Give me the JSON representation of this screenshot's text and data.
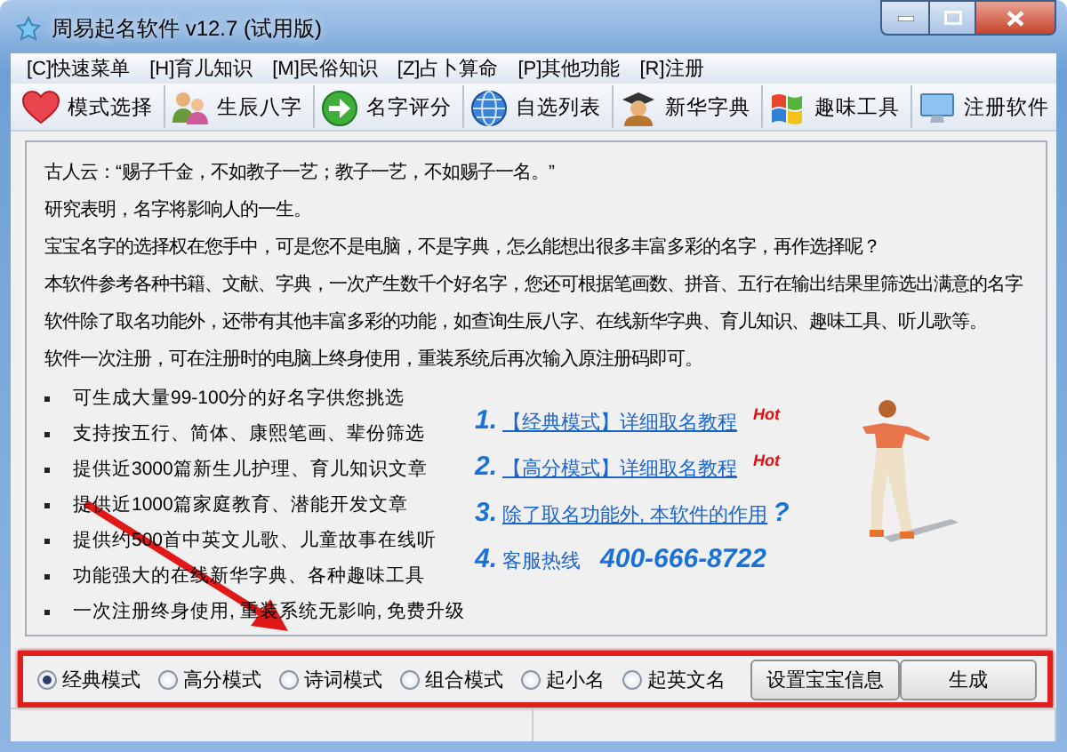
{
  "window": {
    "title": "周易起名软件 v12.7 (试用版)"
  },
  "menu": [
    "[C]快速菜单",
    "[H]育儿知识",
    "[M]民俗知识",
    "[Z]占卜算命",
    "[P]其他功能",
    "[R]注册"
  ],
  "toolbar": [
    "模式选择",
    "生辰八字",
    "名字评分",
    "自选列表",
    "新华字典",
    "趣味工具",
    "注册软件"
  ],
  "intro": {
    "paragraphs": [
      "古人云：“赐子千金，不如教子一艺；教子一艺，不如赐子一名。”",
      "研究表明，名字将影响人的一生。",
      "宝宝名字的选择权在您手中，可是您不是电脑，不是字典，怎么能想出很多丰富多彩的名字，再作选择呢？",
      "本软件参考各种书籍、文献、字典，一次产生数千个好名字，您还可根据笔画数、拼音、五行在输出结果里筛选出满意的名字",
      "软件除了取名功能外，还带有其他丰富多彩的功能，如查询生辰八字、在线新华字典、育儿知识、趣味工具、听儿歌等。",
      "软件一次注册，可在注册时的电脑上终身使用，重装系统后再次输入原注册码即可。"
    ],
    "bullets": [
      "可生成大量99-100分的好名字供您挑选",
      "支持按五行、简体、康熙笔画、辈份筛选",
      "提供近3000篇新生儿护理、育儿知识文章",
      "提供近1000篇家庭教育、潜能开发文章",
      "提供约500首中英文儿歌、儿童故事在线听",
      "功能强大的在线新华字典、各种趣味工具",
      "一次注册终身使用, 重装系统无影响, 免费升级"
    ]
  },
  "links": [
    {
      "kind": "link",
      "number": "1.",
      "text": "【经典模式】详细取名教程",
      "badge": "Hot"
    },
    {
      "kind": "link",
      "number": "2.",
      "text": "【高分模式】详细取名教程",
      "badge": "Hot"
    },
    {
      "kind": "link",
      "number": "3.",
      "text": "除了取名功能外, 本软件的作用",
      "suffix": "?"
    },
    {
      "kind": "hotline",
      "number": "4.",
      "text": "客服热线",
      "phone": "400-666-8722"
    }
  ],
  "modes": [
    {
      "label": "经典模式",
      "selected": true
    },
    {
      "label": "高分模式",
      "selected": false
    },
    {
      "label": "诗词模式",
      "selected": false
    },
    {
      "label": "组合模式",
      "selected": false
    },
    {
      "label": "起小名",
      "selected": false
    },
    {
      "label": "起英文名",
      "selected": false
    }
  ],
  "buttons": [
    "设置宝宝信息",
    "生成"
  ]
}
